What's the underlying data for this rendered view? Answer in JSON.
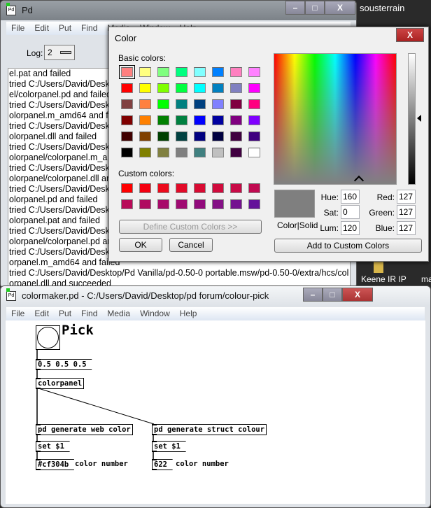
{
  "desktop": {
    "label_top": "sousterrain",
    "icon1": "Keene IR IP",
    "icon2": "ma"
  },
  "pd_window": {
    "title": "Pd",
    "menu": [
      "File",
      "Edit",
      "Put",
      "Find",
      "Media",
      "Window",
      "Help"
    ],
    "log_label": "Log:",
    "log_value": "2",
    "console_lines": [
      "el.pat and failed",
      "tried C:/Users/David/Desk",
      "el/colorpanel.pd and failed",
      "tried C:/Users/David/Desk",
      "olorpanel.m_amd64 and f",
      "tried C:/Users/David/Desk",
      "olorpanel.dll and failed",
      "tried C:/Users/David/Desk",
      "olorpanel/colorpanel.m_a",
      "tried C:/Users/David/Desk",
      "olorpanel/colorpanel.dll ar",
      "tried C:/Users/David/Desk",
      "olorpanel.pd and failed",
      "tried C:/Users/David/Desk",
      "olorpanel.pat and failed",
      "tried C:/Users/David/Desk",
      "olorpanel/colorpanel.pd ar",
      "tried C:/Users/David/Desk",
      "orpanel.m_amd64 and failed",
      "tried C:/Users/David/Desktop/Pd Vanilla/pd-0.50-0 portable.msw/pd-0.50-0/extra/hcs/col",
      "orpanel.dll and succeeded"
    ]
  },
  "color_dialog": {
    "title": "Color",
    "basic_label": "Basic colors:",
    "custom_label": "Custom colors:",
    "basic_colors": [
      "#ff8080",
      "#ffff80",
      "#80ff80",
      "#00ff80",
      "#80ffff",
      "#0080ff",
      "#ff80c0",
      "#ff80ff",
      "#ff0000",
      "#ffff00",
      "#80ff00",
      "#00ff40",
      "#00ffff",
      "#0080c0",
      "#8080c0",
      "#ff00ff",
      "#804040",
      "#ff8040",
      "#00ff00",
      "#008080",
      "#004080",
      "#8080ff",
      "#800040",
      "#ff0080",
      "#800000",
      "#ff8000",
      "#008000",
      "#008040",
      "#0000ff",
      "#0000a0",
      "#800080",
      "#8000ff",
      "#400000",
      "#804000",
      "#004000",
      "#004040",
      "#000080",
      "#000040",
      "#400040",
      "#400080",
      "#000000",
      "#808000",
      "#808040",
      "#808080",
      "#408080",
      "#c0c0c0",
      "#400040",
      "#ffffff"
    ],
    "custom_colors": [
      "#ff0000",
      "#f40010",
      "#ec0a1c",
      "#e20a28",
      "#d80a32",
      "#d00a3c",
      "#c80a46",
      "#c00a50",
      "#b80a58",
      "#b00a60",
      "#a80a6a",
      "#a00a72",
      "#920a7c",
      "#841086",
      "#741290",
      "#64129a"
    ],
    "define_custom": "Define Custom Colors >>",
    "ok": "OK",
    "cancel": "Cancel",
    "color_solid": "Color|Solid",
    "hue_label": "Hue:",
    "hue": "160",
    "sat_label": "Sat:",
    "sat": "0",
    "lum_label": "Lum:",
    "lum": "120",
    "red_label": "Red:",
    "red": "127",
    "green_label": "Green:",
    "green": "127",
    "blue_label": "Blue:",
    "blue": "127",
    "add_custom": "Add to Custom Colors",
    "preview_color": "#7f7f7f",
    "close": "X"
  },
  "patch_window": {
    "title": "colormaker.pd  - C:/Users/David/Desktop/pd forum/colour-pick",
    "menu": [
      "File",
      "Edit",
      "Put",
      "Find",
      "Media",
      "Window",
      "Help"
    ],
    "pick_label": "Pick",
    "msg_rgb": "0.5 0.5 0.5",
    "obj_colorpanel": "colorpanel",
    "obj_web": "pd generate web color",
    "obj_struct": "pd generate struct colour",
    "set1": "set $1",
    "set2": "set $1",
    "out_web": "#cf304b",
    "out_struct": "622",
    "comment1": "color number",
    "comment2": "color number"
  }
}
